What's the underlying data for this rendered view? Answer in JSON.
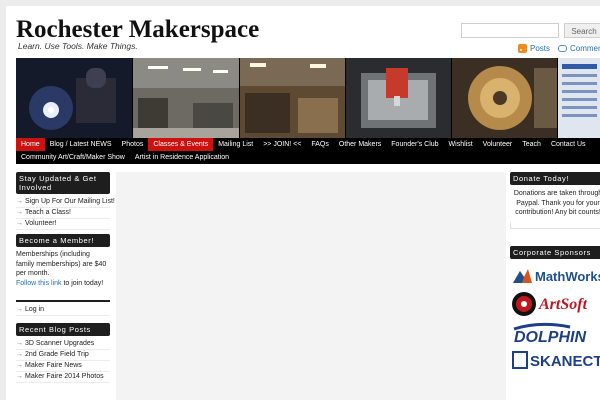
{
  "header": {
    "site_title": "Rochester Makerspace",
    "tagline": "Learn. Use Tools. Make Things.",
    "search_placeholder": "",
    "search_button": "Search",
    "posts_link": "Posts",
    "comments_link": "Comments"
  },
  "nav": {
    "row1": [
      {
        "label": "Home",
        "active": true
      },
      {
        "label": "Blog / Latest NEWS",
        "active": false
      },
      {
        "label": "Photos",
        "active": false
      },
      {
        "label": "Classes & Events",
        "active": true
      },
      {
        "label": "Mailing List",
        "active": false
      },
      {
        "label": ">> JOIN! <<",
        "active": false
      },
      {
        "label": "FAQs",
        "active": false
      },
      {
        "label": "Other Makers",
        "active": false
      },
      {
        "label": "Founder's Club",
        "active": false
      },
      {
        "label": "Wishlist",
        "active": false
      },
      {
        "label": "Volunteer",
        "active": false
      },
      {
        "label": "Teach",
        "active": false
      },
      {
        "label": "Contact Us",
        "active": false
      }
    ],
    "row2": [
      {
        "label": "Community Art/Craft/Maker Show",
        "active": false
      },
      {
        "label": "Artist in Residence Application",
        "active": false
      }
    ]
  },
  "sidebar_left": {
    "stay_updated": {
      "title": "Stay Updated & Get Involved",
      "items": [
        "Sign Up For Our Mailing List!",
        "Teach a Class!",
        "Volunteer!"
      ]
    },
    "member": {
      "title": "Become a Member!",
      "text": "Memberships (including family memberships) are $40 per month.",
      "link": "Follow this link",
      "link_suffix": " to join today!"
    },
    "meta": {
      "items": [
        "Log in"
      ]
    },
    "recent_posts": {
      "title": "Recent Blog Posts",
      "items": [
        "3D Scanner Upgrades",
        "2nd Grade Field Trip",
        "Maker Faire News",
        "Maker Faire 2014 Photos"
      ]
    }
  },
  "sidebar_right": {
    "donate": {
      "title": "Donate Today!",
      "text": "Donations are taken through Paypal. Thank you for your contribution! Any bit counts!"
    },
    "sponsors": {
      "title": "Corporate Sponsors",
      "logos": [
        {
          "name": "MathWorks",
          "color": "#1f4f8f"
        },
        {
          "name": "ArtSoft",
          "color": "#c0161e"
        },
        {
          "name": "DOLPHIN",
          "color": "#1d3f8a"
        },
        {
          "name": "SKANECT",
          "color": "#1d3f8a"
        }
      ]
    }
  },
  "colors": {
    "nav_active": "#cc1111",
    "nav_bg": "#000000",
    "link": "#2a6fb0",
    "widget_title_bg": "#1e1e1e"
  }
}
